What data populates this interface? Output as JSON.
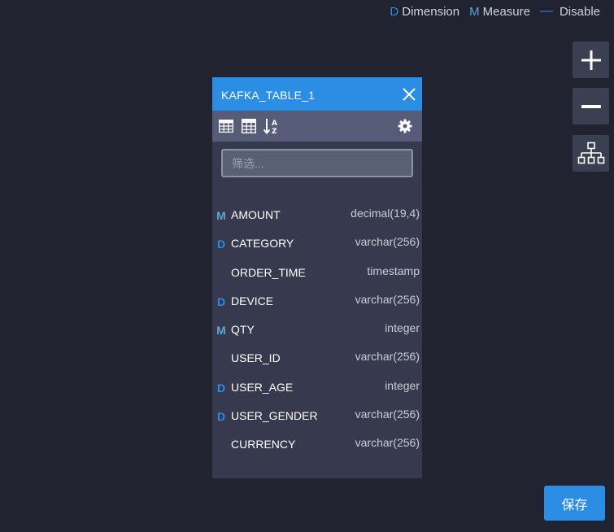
{
  "legend": {
    "dimension": {
      "mark": "D",
      "label": "Dimension"
    },
    "measure": {
      "mark": "M",
      "label": "Measure"
    },
    "disable": {
      "mark": "—",
      "label": "Disable"
    }
  },
  "tools": {
    "zoom_in_icon": "plus-icon",
    "zoom_out_icon": "minus-icon",
    "layout_icon": "hierarchy-icon"
  },
  "card": {
    "title": "KAFKA_TABLE_1",
    "filter_placeholder": "筛选...",
    "filter_value": "",
    "fields": [
      {
        "mark": "M",
        "name": "AMOUNT",
        "dtype": "decimal(19,4)"
      },
      {
        "mark": "D",
        "name": "CATEGORY",
        "dtype": "varchar(256)"
      },
      {
        "mark": "",
        "name": "ORDER_TIME",
        "dtype": "timestamp"
      },
      {
        "mark": "D",
        "name": "DEVICE",
        "dtype": "varchar(256)"
      },
      {
        "mark": "M",
        "name": "QTY",
        "dtype": "integer"
      },
      {
        "mark": "",
        "name": "USER_ID",
        "dtype": "varchar(256)"
      },
      {
        "mark": "D",
        "name": "USER_AGE",
        "dtype": "integer"
      },
      {
        "mark": "D",
        "name": "USER_GENDER",
        "dtype": "varchar(256)"
      },
      {
        "mark": "",
        "name": "CURRENCY",
        "dtype": "varchar(256)"
      }
    ]
  },
  "save_label": "保存",
  "colors": {
    "accent": "#2b8ee4",
    "background": "#212330",
    "card": "#373a4e",
    "dimension": "#2a8ce6",
    "measure": "#56a9cf"
  }
}
